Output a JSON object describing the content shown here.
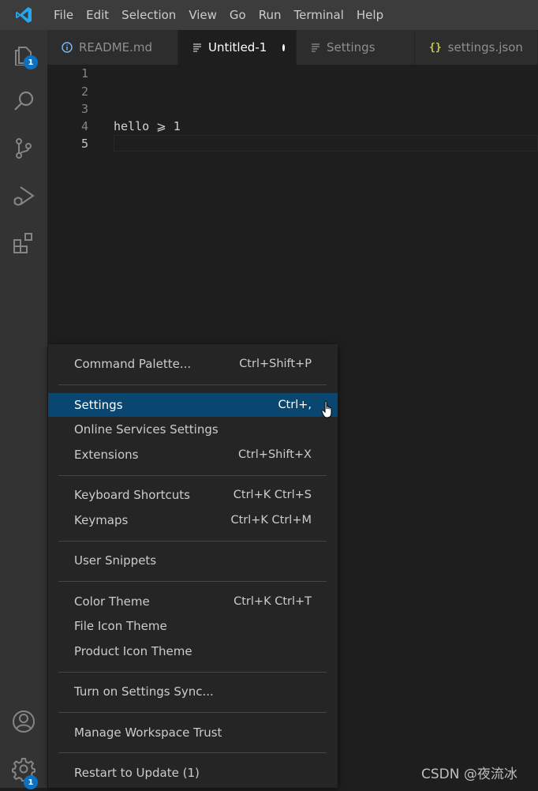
{
  "menubar": [
    "File",
    "Edit",
    "Selection",
    "View",
    "Go",
    "Run",
    "Terminal",
    "Help"
  ],
  "activity": {
    "explorer_badge": "1",
    "manage_badge": "1"
  },
  "tabs": [
    {
      "label": "README.md",
      "icon": "info-icon",
      "active": false
    },
    {
      "label": "Untitled-1",
      "icon": "text-file-icon",
      "active": true,
      "dirty": true
    },
    {
      "label": "Settings",
      "icon": "text-file-icon",
      "active": false
    },
    {
      "label": "settings.json",
      "icon": "json-braces-icon",
      "active": false
    }
  ],
  "editor": {
    "lines": [
      {
        "num": "1",
        "text": ""
      },
      {
        "num": "2",
        "text": ""
      },
      {
        "num": "3",
        "text": ""
      },
      {
        "num": "4",
        "text": "hello ⩾ 1"
      },
      {
        "num": "5",
        "text": ""
      }
    ],
    "current_line": 5
  },
  "context_menu": {
    "items": [
      {
        "label": "Command Palette...",
        "shortcut": "Ctrl+Shift+P"
      },
      {
        "label": "Settings",
        "shortcut": "Ctrl+,",
        "highlighted": true
      },
      {
        "label": "Online Services Settings",
        "shortcut": ""
      },
      {
        "label": "Extensions",
        "shortcut": "Ctrl+Shift+X"
      },
      {
        "label": "Keyboard Shortcuts",
        "shortcut": "Ctrl+K Ctrl+S"
      },
      {
        "label": "Keymaps",
        "shortcut": "Ctrl+K Ctrl+M"
      },
      {
        "label": "User Snippets",
        "shortcut": ""
      },
      {
        "label": "Color Theme",
        "shortcut": "Ctrl+K Ctrl+T"
      },
      {
        "label": "File Icon Theme",
        "shortcut": ""
      },
      {
        "label": "Product Icon Theme",
        "shortcut": ""
      },
      {
        "label": "Turn on Settings Sync...",
        "shortcut": ""
      },
      {
        "label": "Manage Workspace Trust",
        "shortcut": ""
      },
      {
        "label": "Restart to Update (1)",
        "shortcut": ""
      }
    ]
  },
  "watermark": "CSDN @夜流冰",
  "colors": {
    "titlebar": "#3c3c3c",
    "activitybar": "#333333",
    "editor_bg": "#1e1e1e",
    "menu_bg": "#252526",
    "menu_highlight": "#094771",
    "badge": "#0e70c0",
    "vscode_blue": "#23a9f2"
  }
}
